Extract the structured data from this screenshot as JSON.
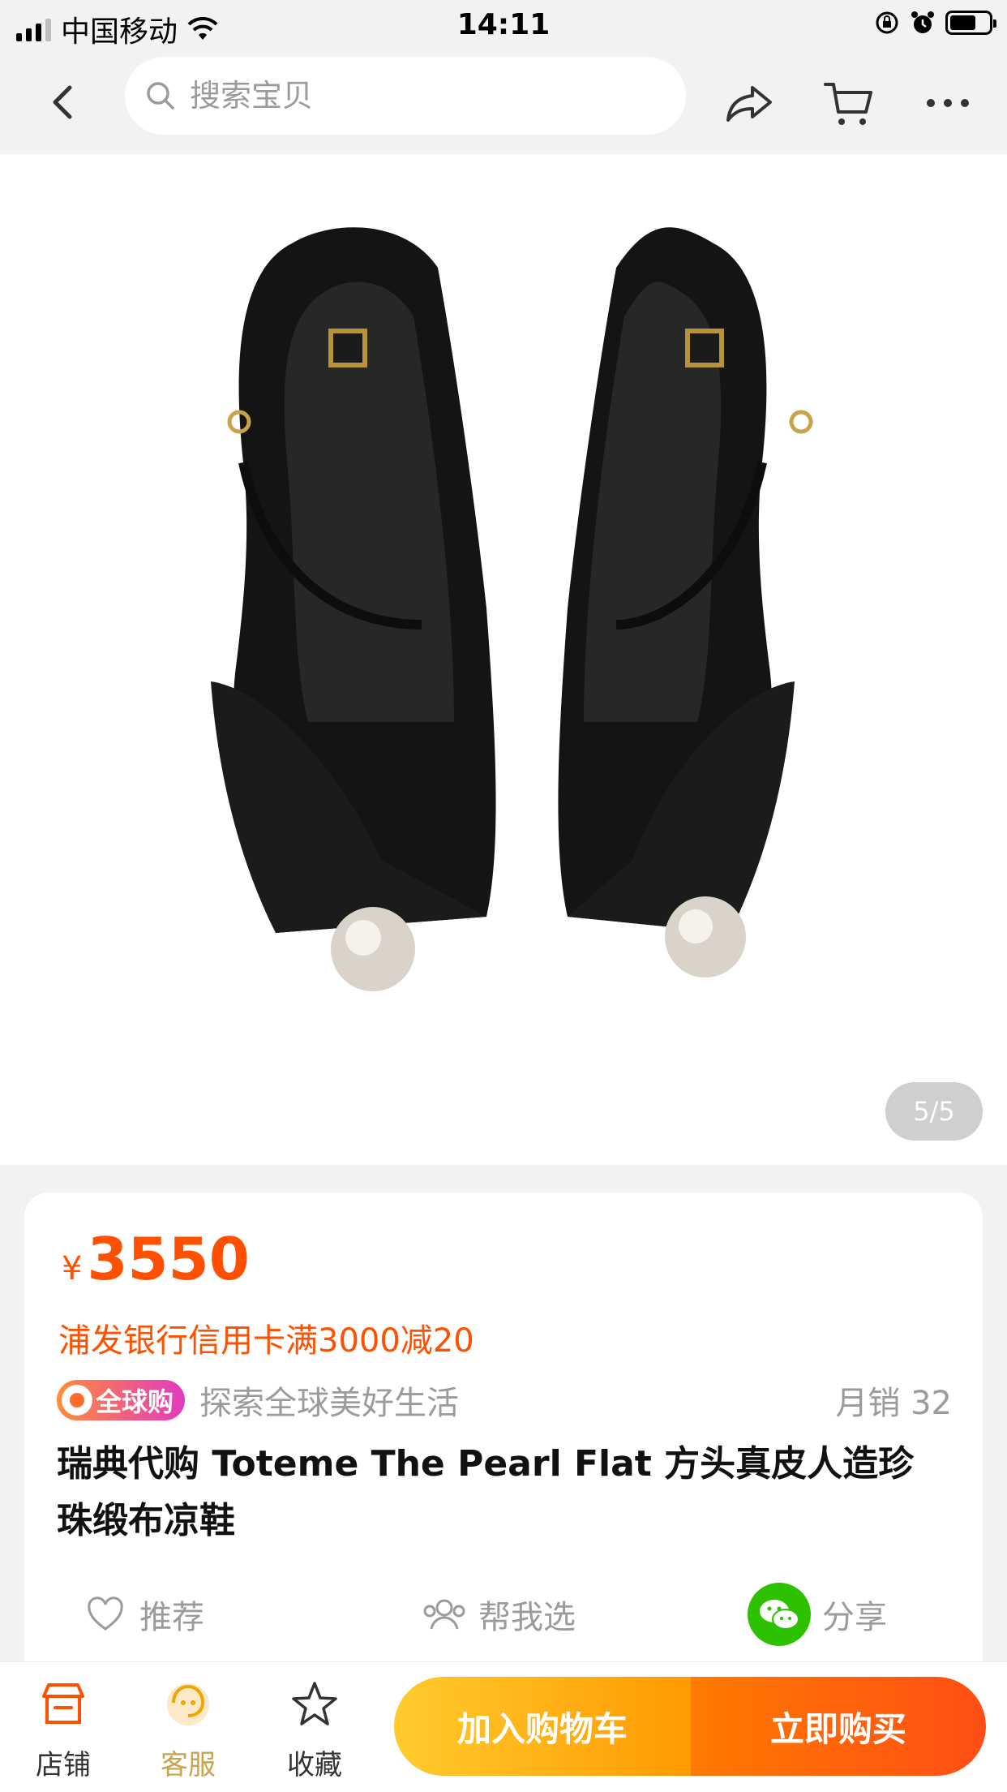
{
  "status_bar": {
    "carrier": "中国移动",
    "time": "14:11"
  },
  "search": {
    "placeholder": "搜索宝贝"
  },
  "gallery": {
    "page_indicator": "5/5"
  },
  "product": {
    "currency": "¥",
    "price": "3550",
    "promo": "浦发银行信用卡满3000减20",
    "badge": "全球购",
    "tagline": "探索全球美好生活",
    "monthly_sales": "月销   32",
    "title": "瑞典代购 Toteme The Pearl Flat 方头真皮人造珍珠缎布凉鞋"
  },
  "actions": {
    "recommend": "推荐",
    "help_choose": "帮我选",
    "share": "分享"
  },
  "bottom_bar": {
    "store": "店铺",
    "service": "客服",
    "favorite": "收藏",
    "add_to_cart": "加入购物车",
    "buy_now": "立即购买"
  },
  "colors": {
    "accent": "#ff5000",
    "cart": "#ffb000",
    "buy": "#ff5a10",
    "wechat": "#2dc100"
  },
  "icons": [
    "back-icon",
    "search-icon",
    "share-icon",
    "cart-icon",
    "more-icon",
    "heart-icon",
    "people-icon",
    "wechat-icon",
    "store-icon",
    "service-icon",
    "star-icon"
  ]
}
